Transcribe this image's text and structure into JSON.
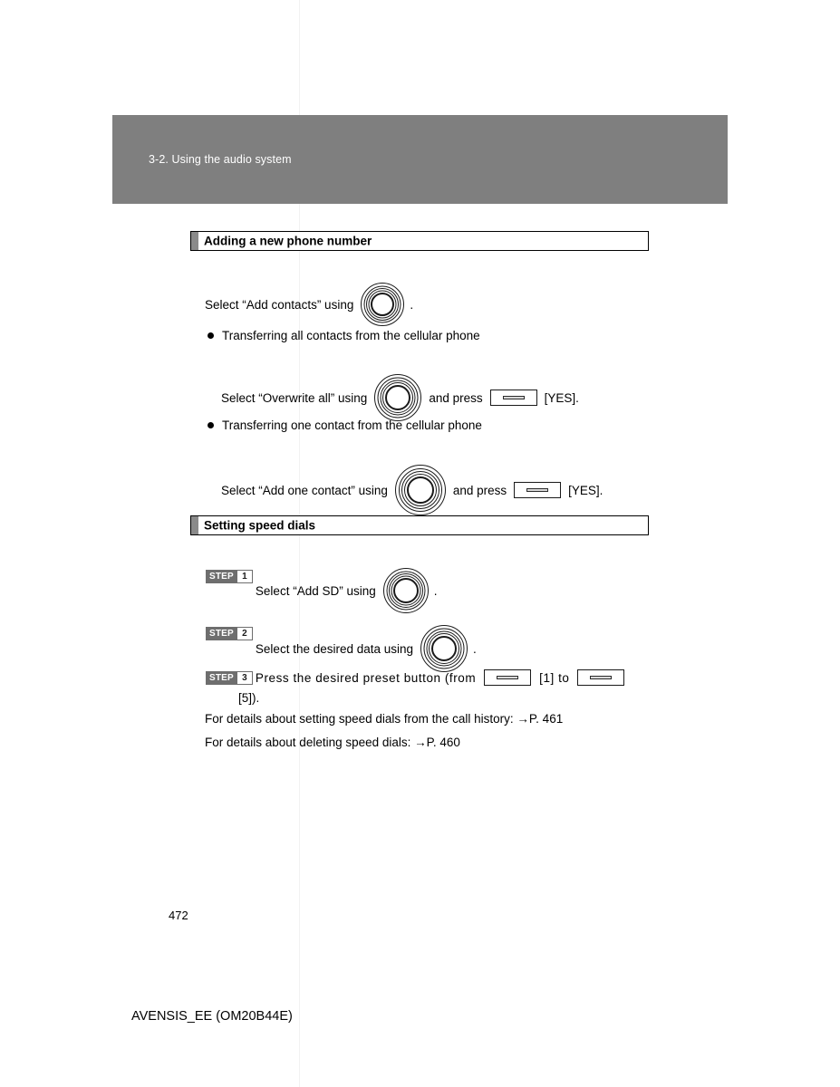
{
  "document": {
    "running_header": "3-2. Using the audio system",
    "page_number": "472",
    "footer": "AVENSIS_EE (OM20B44E)"
  },
  "sections": [
    {
      "heading": "Adding a new phone number",
      "intro": {
        "before": "Select “Add contacts” using",
        "icon": "knob-icon",
        "after": "."
      },
      "bullets": [
        {
          "label": "Transferring all contacts from the cellular phone",
          "instruction": {
            "before": "Select “Overwrite all” using",
            "icon1": "knob-icon",
            "middle": "and press",
            "icon2": "preset-button-icon",
            "after": "[YES]."
          }
        },
        {
          "label": "Transferring one contact from the cellular phone",
          "instruction": {
            "before": "Select “Add one contact” using",
            "icon1": "knob-icon",
            "middle": "and press",
            "icon2": "preset-button-icon",
            "after": "[YES]."
          }
        }
      ]
    },
    {
      "heading": "Setting speed dials",
      "steps": [
        {
          "word": "STEP",
          "number": "1",
          "before": "Select “Add SD” using",
          "icon": "knob-icon",
          "after": "."
        },
        {
          "word": "STEP",
          "number": "2",
          "before": "Select the desired data using",
          "icon": "knob-icon",
          "after": "."
        },
        {
          "word": "STEP",
          "number": "3",
          "before": "Press the desired preset button (from",
          "icon1": "preset-button-icon",
          "middle": "[1] to",
          "icon2": "preset-button-icon",
          "after": "[5])."
        }
      ],
      "notes": [
        "For details about setting speed dials from the call history: →P. 461",
        "For details about deleting speed dials: →P. 460"
      ]
    }
  ],
  "colors": {
    "banner_gray": "#7f7f7f",
    "section_tab_gray": "#8a8a8a",
    "step_badge_gray": "#6e6e6e",
    "text": "#000000"
  }
}
